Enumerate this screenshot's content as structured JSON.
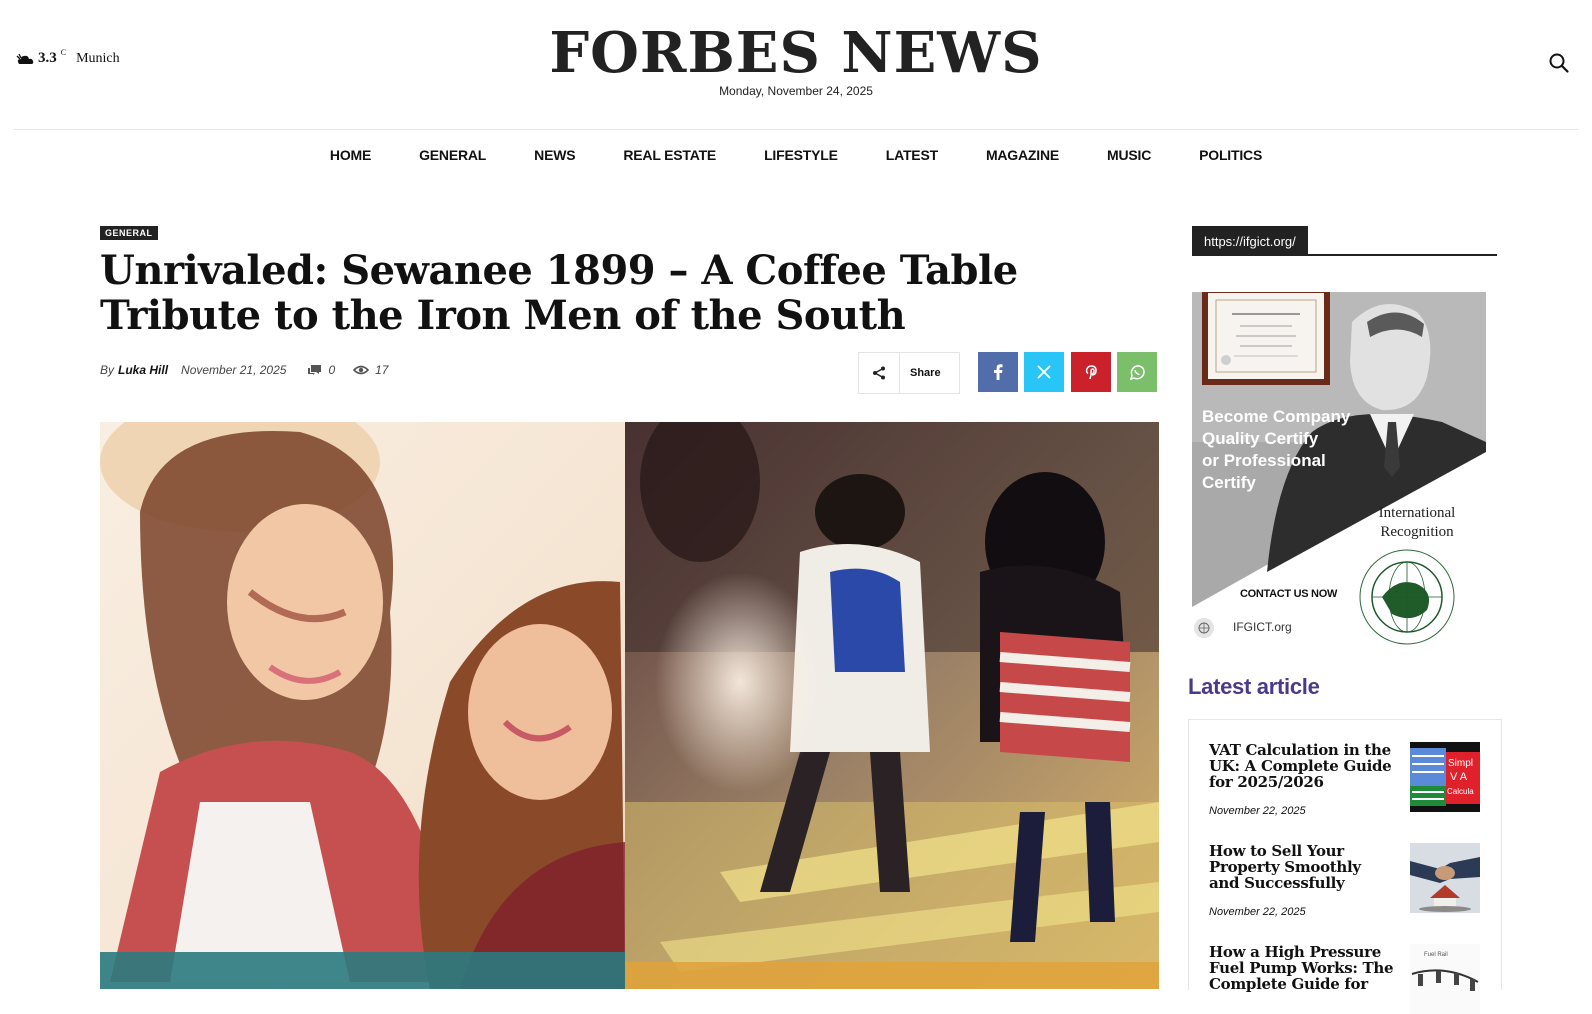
{
  "header": {
    "temperature": "3.3",
    "temp_unit": "C",
    "city": "Munich",
    "site_title": "FORBES NEWS",
    "date": "Monday, November 24, 2025"
  },
  "nav": {
    "items": [
      "HOME",
      "GENERAL",
      "NEWS",
      "REAL ESTATE",
      "LIFESTYLE",
      "LATEST",
      "MAGAZINE",
      "MUSIC",
      "POLITICS"
    ]
  },
  "article": {
    "category": "GENERAL",
    "title": "Unrivaled: Sewanee 1899 – A Coffee Table Tribute to the Iron Men of the South",
    "by": "By",
    "author": "Luka Hill",
    "date": "November 21, 2025",
    "comments": "0",
    "views": "17",
    "share_label": "Share"
  },
  "sidebar": {
    "tag_label": "https://ifgict.org/",
    "ad": {
      "headline_lines": [
        "Become Company",
        "Quality Certify",
        "or Professional",
        "Certify"
      ],
      "recognition_lines": [
        "International",
        "Recognition"
      ],
      "cta": "CONTACT US NOW",
      "site": "IFGICT.org"
    },
    "latest_heading": "Latest article",
    "latest": [
      {
        "title": "VAT Calculation in the UK: A Complete Guide for 2025/2026",
        "date": "November 22, 2025"
      },
      {
        "title": "How to Sell Your Property Smoothly and Successfully",
        "date": "November 22, 2025"
      },
      {
        "title": "How a High Pressure Fuel Pump Works: The Complete Guide for",
        "date": ""
      }
    ]
  },
  "colors": {
    "facebook": "#516eab",
    "twitter": "#29c5f6",
    "pinterest": "#ca212a",
    "whatsapp": "#7bbf6a",
    "latest_heading": "#4a3a8a"
  }
}
